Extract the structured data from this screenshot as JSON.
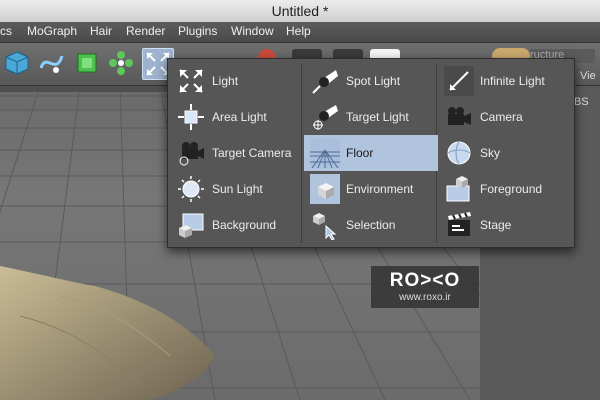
{
  "window": {
    "title": "Untitled *"
  },
  "menubar": {
    "items": [
      "cs",
      "MoGraph",
      "Hair",
      "Render",
      "Plugins",
      "Window",
      "Help"
    ]
  },
  "right_panel": {
    "tab_partial_1": "ructure",
    "tab_partial_2": "Vie",
    "header_partial": "RBS"
  },
  "popup": {
    "columns": [
      [
        {
          "label": "Light",
          "icon": "light-icon"
        },
        {
          "label": "Area Light",
          "icon": "area-light-icon"
        },
        {
          "label": "Target Camera",
          "icon": "target-camera-icon"
        },
        {
          "label": "Sun Light",
          "icon": "sun-light-icon"
        },
        {
          "label": "Background",
          "icon": "background-icon"
        }
      ],
      [
        {
          "label": "Spot Light",
          "icon": "spot-light-icon"
        },
        {
          "label": "Target Light",
          "icon": "target-light-icon"
        },
        {
          "label": "Floor",
          "icon": "floor-icon",
          "selected": true
        },
        {
          "label": "Environment",
          "icon": "environment-icon"
        },
        {
          "label": "Selection",
          "icon": "selection-icon"
        }
      ],
      [
        {
          "label": "Infinite Light",
          "icon": "infinite-light-icon"
        },
        {
          "label": "Camera",
          "icon": "camera-icon"
        },
        {
          "label": "Sky",
          "icon": "sky-icon"
        },
        {
          "label": "Foreground",
          "icon": "foreground-icon"
        },
        {
          "label": "Stage",
          "icon": "stage-icon"
        }
      ]
    ]
  },
  "watermark": {
    "logo": "RO><O",
    "url": "www.roxo.ir"
  },
  "colors": {
    "selection": "#b0c4de",
    "popup_bg": "#565656",
    "menubar": "#4f4f4f"
  }
}
